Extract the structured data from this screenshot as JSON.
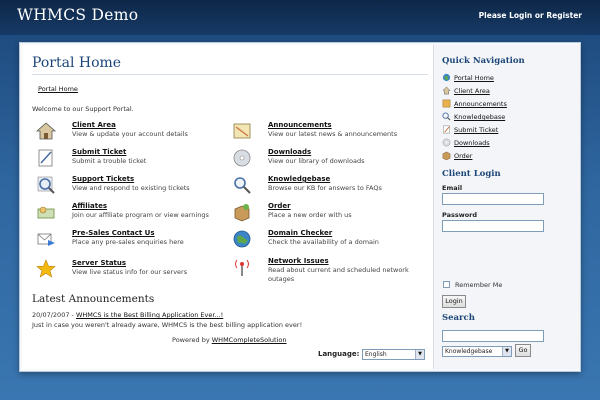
{
  "header": {
    "brand": "WHMCS Demo",
    "please": "Please ",
    "login": "Login",
    "or": " or ",
    "register": "Register"
  },
  "main": {
    "title": "Portal Home",
    "breadcrumb": "Portal Home",
    "welcome": "Welcome to our Support Portal.",
    "tiles": [
      {
        "title": "Client Area",
        "desc": "View & update your account details",
        "icon": "house-icon"
      },
      {
        "title": "Announcements",
        "desc": "View our latest news & announcements",
        "icon": "announcement-icon"
      },
      {
        "title": "Submit Ticket",
        "desc": "Submit a trouble ticket",
        "icon": "ticket-icon"
      },
      {
        "title": "Downloads",
        "desc": "View our library of downloads",
        "icon": "disc-icon"
      },
      {
        "title": "Support Tickets",
        "desc": "View and respond to existing tickets",
        "icon": "magnifier-icon"
      },
      {
        "title": "Knowledgebase",
        "desc": "Browse our KB for answers to FAQs",
        "icon": "search-icon"
      },
      {
        "title": "Affiliates",
        "desc": "Join our affiliate program or view earnings",
        "icon": "money-icon"
      },
      {
        "title": "Order",
        "desc": "Place a new order with us",
        "icon": "box-icon"
      },
      {
        "title": "Pre-Sales Contact Us",
        "desc": "Place any pre-sales enquiries here",
        "icon": "envelope-arrow-icon"
      },
      {
        "title": "Domain Checker",
        "desc": "Check the availability of a domain",
        "icon": "globe-icon"
      },
      {
        "title": "Server Status",
        "desc": "View live status info for our servers",
        "icon": "star-icon"
      },
      {
        "title": "Network Issues",
        "desc": "Read about current and scheduled network outages",
        "icon": "antenna-icon"
      }
    ],
    "latest_heading": "Latest Announcements",
    "announcement": {
      "date": "20/07/2007 - ",
      "title": "WHMCS is the Best Billing Application Ever...!",
      "body": "Just in case you weren't already aware, WHMCS is the best billing application ever!"
    },
    "powered_prefix": "Powered by ",
    "powered_link": "WHMCompleteSolution",
    "language_label": "Language:",
    "language_value": "English"
  },
  "sidebar": {
    "quick_nav_heading": "Quick Navigation",
    "nav": [
      {
        "label": "Portal Home",
        "icon": "globe-icon"
      },
      {
        "label": "Client Area",
        "icon": "house-icon"
      },
      {
        "label": "Announcements",
        "icon": "announcement-icon"
      },
      {
        "label": "Knowledgebase",
        "icon": "magnifier-icon"
      },
      {
        "label": "Submit Ticket",
        "icon": "ticket-icon"
      },
      {
        "label": "Downloads",
        "icon": "disc-icon"
      },
      {
        "label": "Order",
        "icon": "box-icon"
      }
    ],
    "login_heading": "Client Login",
    "email_label": "Email",
    "password_label": "Password",
    "remember_label": "Remember Me",
    "login_button": "Login",
    "search_heading": "Search",
    "search_scope": "Knowledgebase",
    "go_button": "Go"
  },
  "colors": {
    "accent": "#1c4677",
    "topbar": "#0e2748",
    "band": "#2f669f"
  }
}
